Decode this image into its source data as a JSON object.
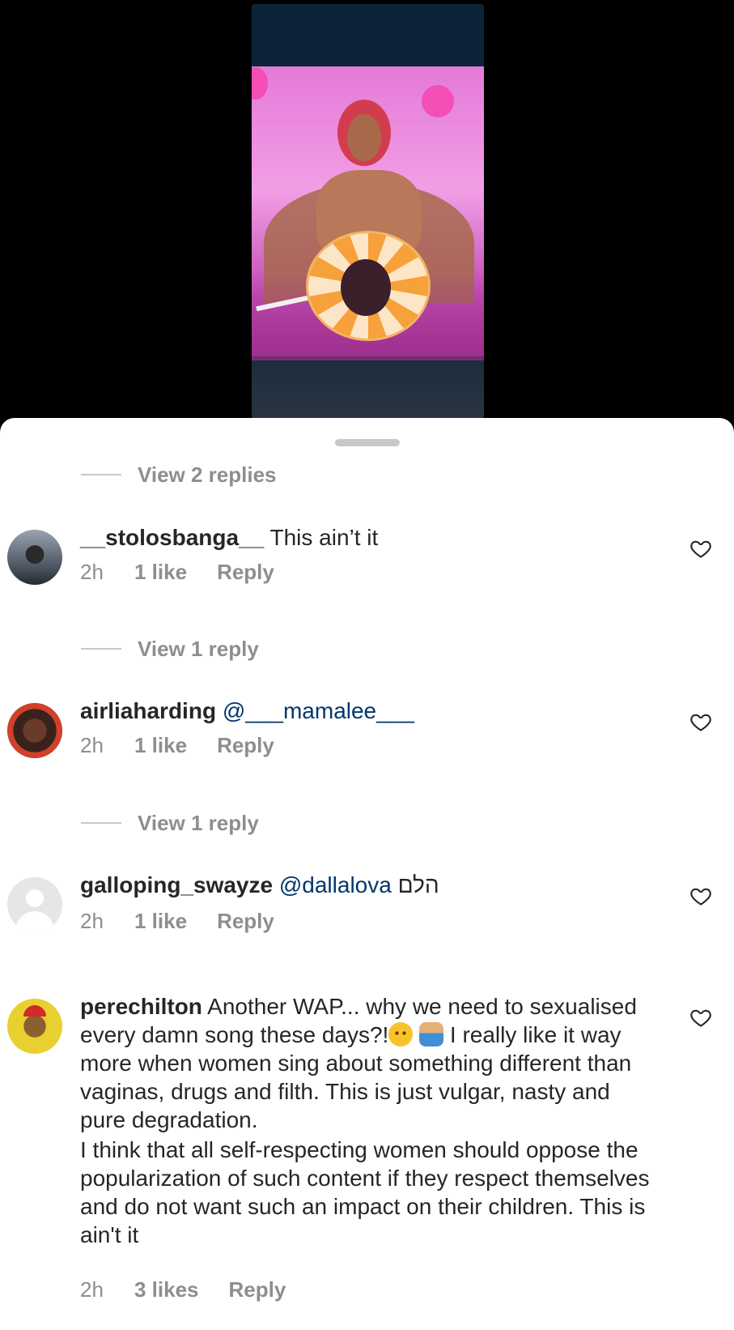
{
  "comments_sheet": {
    "top_replies": "View 2 replies",
    "comments": [
      {
        "username": "__stolosbanga__",
        "text": "This ain’t it",
        "time": "2h",
        "likes": "1 like",
        "reply": "Reply",
        "replies_link": "View 1 reply"
      },
      {
        "username": "airliaharding",
        "mention": "@___mamalee___",
        "text": "",
        "time": "2h",
        "likes": "1 like",
        "reply": "Reply",
        "replies_link": "View 1 reply"
      },
      {
        "username": "galloping_swayze",
        "mention": "@dallalova",
        "text": "הלם",
        "time": "2h",
        "likes": "1 like",
        "reply": "Reply"
      },
      {
        "username": "perechilton",
        "text_part1": "Another WAP... why we need to sexualised every damn song these days?!",
        "text_part2": "I really like it way more when women sing about something different than vaginas, drugs and filth. This is just vulgar, nasty and pure degradation.",
        "text_part3": "I think that all self-respecting women should oppose the popularization of such content if they respect themselves and do not want such an impact on their children. This is ain't it",
        "emojis": [
          "unamused-face",
          "person-shrugging"
        ],
        "time": "2h",
        "likes": "3 likes",
        "reply": "Reply"
      }
    ]
  },
  "icons": {
    "like": "heart-outline-icon"
  }
}
